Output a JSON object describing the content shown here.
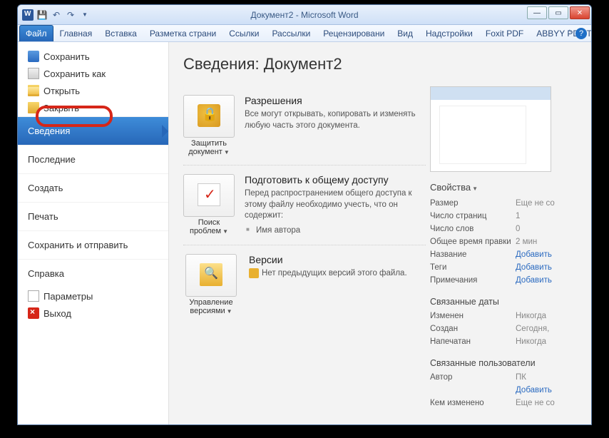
{
  "title": "Документ2 - Microsoft Word",
  "ribbon": {
    "file": "Файл",
    "tabs": [
      "Главная",
      "Вставка",
      "Разметка страни",
      "Ссылки",
      "Рассылки",
      "Рецензировани",
      "Вид",
      "Надстройки",
      "Foxit PDF",
      "ABBYY PDF Trans"
    ]
  },
  "menu": {
    "save": "Сохранить",
    "saveas": "Сохранить как",
    "open": "Открыть",
    "close": "Закрыть",
    "info": "Сведения",
    "recent": "Последние",
    "new": "Создать",
    "print": "Печать",
    "share": "Сохранить и отправить",
    "help": "Справка",
    "options": "Параметры",
    "exit": "Выход"
  },
  "info": {
    "heading": "Сведения: Документ2",
    "protect_btn": "Защитить документ",
    "perm_title": "Разрешения",
    "perm_body": "Все могут открывать, копировать и изменять любую часть этого документа.",
    "issues_btn": "Поиск проблем",
    "share_title": "Подготовить к общему доступу",
    "share_body": "Перед распространением общего доступа к этому файлу необходимо учесть, что он содержит:",
    "share_item1": "Имя автора",
    "versions_btn": "Управление версиями",
    "ver_title": "Версии",
    "ver_body": "Нет предыдущих версий этого файла."
  },
  "props": {
    "header": "Свойства",
    "size_k": "Размер",
    "size_v": "Еще не со",
    "pages_k": "Число страниц",
    "pages_v": "1",
    "words_k": "Число слов",
    "words_v": "0",
    "edit_k": "Общее время правки",
    "edit_v": "2 мин",
    "title_k": "Название",
    "title_v": "Добавить",
    "tags_k": "Теги",
    "tags_v": "Добавить",
    "comments_k": "Примечания",
    "comments_v": "Добавить",
    "dates_header": "Связанные даты",
    "modified_k": "Изменен",
    "modified_v": "Никогда",
    "created_k": "Создан",
    "created_v": "Сегодня,",
    "printed_k": "Напечатан",
    "printed_v": "Никогда",
    "people_header": "Связанные пользователи",
    "author_k": "Автор",
    "author_v": "ПК",
    "author_add": "Добавить",
    "lastmod_k": "Кем изменено",
    "lastmod_v": "Еще не со"
  }
}
